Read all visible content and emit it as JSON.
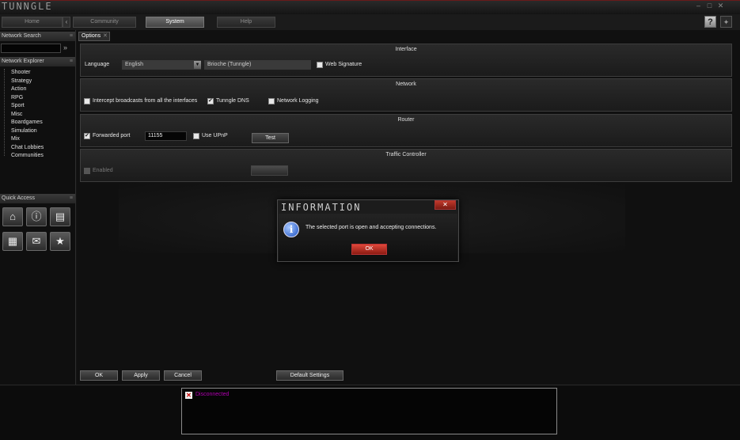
{
  "app": {
    "logo": "TUNNGLE",
    "window_controls": [
      "–",
      "□",
      "✕"
    ]
  },
  "nav": {
    "tabs": [
      {
        "label": "Home",
        "active": false
      },
      {
        "label": "Community",
        "active": false
      },
      {
        "label": "System",
        "active": true
      },
      {
        "label": "Help",
        "active": false
      }
    ],
    "arrow": "‹",
    "help": "?",
    "extra_icon": "puzzle-icon"
  },
  "sidebar": {
    "network_search_title": "Network Search",
    "network_explorer_title": "Network Explorer",
    "categories": [
      "Shooter",
      "Strategy",
      "Action",
      "RPG",
      "Sport",
      "Misc",
      "Boardgames",
      "Simulation",
      "Mix",
      "Chat Lobbies",
      "Communities"
    ],
    "quick_access_title": "Quick Access",
    "quick_access_icons": [
      "home-icon",
      "info-icon",
      "library-icon",
      "grid-icon",
      "chat-icon",
      "star-icon"
    ]
  },
  "options": {
    "tab_label": "Options",
    "interface": {
      "title": "Interface",
      "language_label": "Language",
      "language_value": "English",
      "skin_value": "Brioche (Tunngle)",
      "web_signature_label": "Web Signature",
      "web_signature_checked": false
    },
    "network": {
      "title": "Network",
      "intercept_label": "Intercept broadcasts from all the interfaces",
      "intercept_checked": false,
      "dns_label": "Tunngle DNS",
      "dns_checked": true,
      "logging_label": "Network Logging",
      "logging_checked": false
    },
    "router": {
      "title": "Router",
      "forwarded_label": "Forwarded port",
      "forwarded_checked": true,
      "port_value": "11155",
      "upnp_label": "Use UPnP",
      "upnp_checked": false,
      "test_label": "Test"
    },
    "traffic": {
      "title": "Traffic Controller",
      "enabled_label": "Enabled",
      "enabled_checked": false
    },
    "buttons": {
      "ok": "OK",
      "apply": "Apply",
      "cancel": "Cancel",
      "defaults": "Default Settings"
    }
  },
  "dialog": {
    "title": "INFORMATION",
    "message": "The selected port is open and accepting connections.",
    "ok": "OK",
    "close": "✕"
  },
  "footer": {
    "log_entry": "Disconnected"
  }
}
